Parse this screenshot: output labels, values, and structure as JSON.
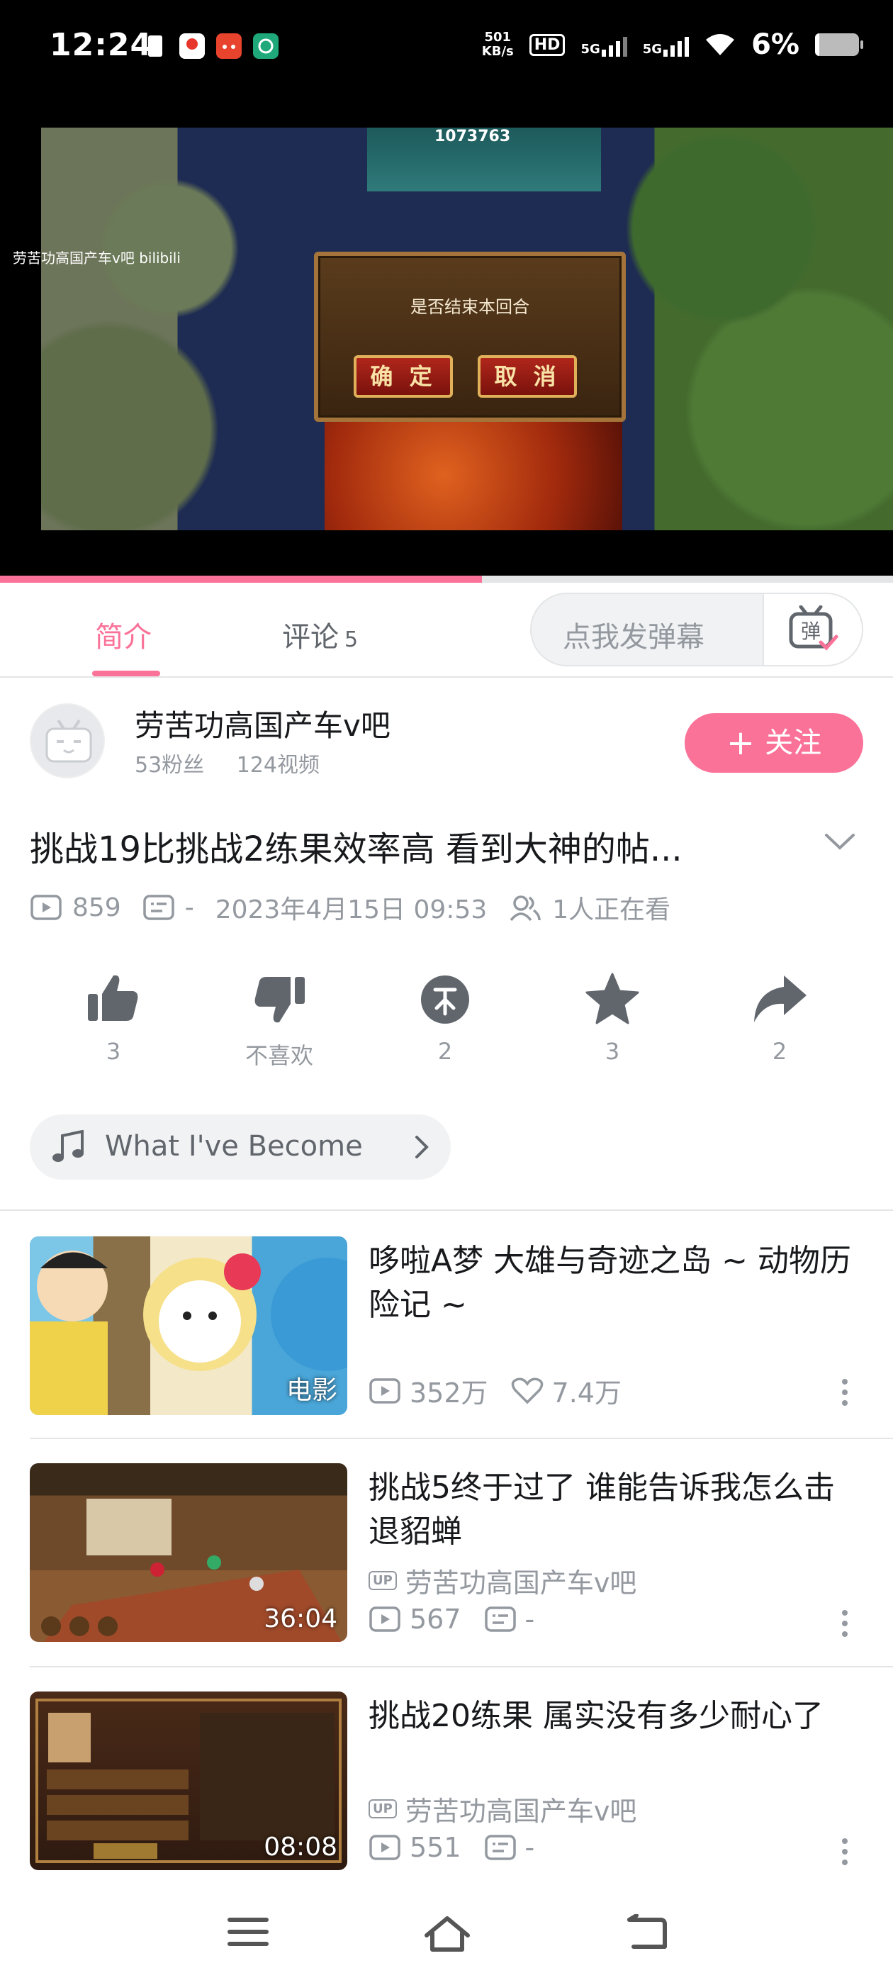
{
  "status_bar": {
    "time": "12:24",
    "net_speed_value": "501",
    "net_speed_unit": "KB/s",
    "hd_label": "HD",
    "sig1": "5G",
    "sig2": "5G",
    "battery": "6%",
    "battery_level": 0.06,
    "icons": [
      "sim-icon",
      "map-app-icon",
      "shop-app-icon",
      "wifi-app-icon"
    ]
  },
  "player": {
    "hud_counter": "1073763",
    "watermark": "劳苦功高国产车v吧 bilibili",
    "dialog_text": "是否结束本回合",
    "confirm_label": "确 定",
    "cancel_label": "取 消",
    "progress": 0.54
  },
  "tabs": {
    "intro": "简介",
    "comments": "评论",
    "comments_count": "5",
    "danmaku_placeholder": "点我发弹幕",
    "danmaku_icon": "弹"
  },
  "uploader": {
    "name": "劳苦功高国产车v吧",
    "fans": "53粉丝",
    "videos": "124视频",
    "follow_label": "关注"
  },
  "video": {
    "title": "挑战19比挑战2练果效率高 看到大神的帖...",
    "views": "859",
    "danmaku_count": "-",
    "date": "2023年4月15日 09:53",
    "watching": "1人正在看"
  },
  "actions": {
    "like": "3",
    "dislike": "不喜欢",
    "coin": "2",
    "favorite": "3",
    "share": "2"
  },
  "music": {
    "title": "What I've Become"
  },
  "related": [
    {
      "title": "哆啦A梦 大雄与奇迹之岛 ~ 动物历险记 ~",
      "badge": "电影",
      "views": "352万",
      "likes": "7.4万"
    },
    {
      "title": "挑战5终于过了 谁能告诉我怎么击退貂蝉",
      "badge": "36:04",
      "up_tag": "UP",
      "uploader": "劳苦功高国产车v吧",
      "views": "567",
      "danmaku": "-"
    },
    {
      "title": "挑战20练果  属实没有多少耐心了",
      "badge": "08:08",
      "up_tag": "UP",
      "uploader": "劳苦功高国产车v吧",
      "views": "551",
      "danmaku": "-"
    }
  ],
  "colors": {
    "accent": "#fb7299",
    "muted": "#9499a0",
    "text": "#18191c"
  }
}
